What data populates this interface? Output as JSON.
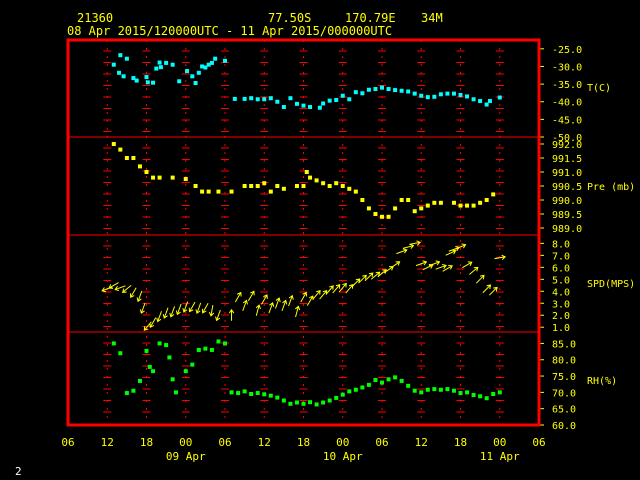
{
  "header": {
    "station_id": "21360",
    "latitude": "77.50S",
    "longitude": "170.79E",
    "elevation": "34M",
    "time_range": "08 Apr 2015/120000UTC - 11 Apr 2015/000000UTC"
  },
  "page_number": "2",
  "colors": {
    "frame": "#ff0000",
    "grid": "#ff0000",
    "labels": "#ffff00",
    "temperature": "#00ffff",
    "pressure": "#ffff00",
    "wind": "#ffff00",
    "humidity": "#00ff00"
  },
  "chart_data": {
    "type": "scatter",
    "x_axis": {
      "unit": "hours from 08 Apr 2015 00UTC",
      "range": [
        6,
        78
      ],
      "tick_labels": [
        "06",
        "12",
        "18",
        "00",
        "06",
        "12",
        "18",
        "00",
        "06",
        "12",
        "18",
        "00",
        "06"
      ],
      "date_labels": [
        "09 Apr",
        "10 Apr",
        "11 Apr"
      ]
    },
    "panels": [
      {
        "name": "temperature",
        "label": "T(C)",
        "ticks": [
          "-25.0",
          "-30.0",
          "-35.0",
          "-40.0",
          "-45.0",
          "-50.0"
        ],
        "ylim": [
          -50,
          -22.5
        ],
        "points": [
          [
            13,
            -29.5
          ],
          [
            14,
            -26.8
          ],
          [
            15,
            -27.8
          ],
          [
            13.8,
            -31.8
          ],
          [
            14.5,
            -32.8
          ],
          [
            16,
            -33.3
          ],
          [
            16.5,
            -34.0
          ],
          [
            18,
            -33.0
          ],
          [
            18.2,
            -34.5
          ],
          [
            19,
            -34.6
          ],
          [
            19.5,
            -30.6
          ],
          [
            20,
            -28.9
          ],
          [
            20.2,
            -30.2
          ],
          [
            21,
            -29.0
          ],
          [
            22,
            -29.5
          ],
          [
            23,
            -34.2
          ],
          [
            24.2,
            -31.3
          ],
          [
            25,
            -32.8
          ],
          [
            25.5,
            -34.7
          ],
          [
            26,
            -31.8
          ],
          [
            26.5,
            -30.0
          ],
          [
            27,
            -30.3
          ],
          [
            27.5,
            -29.5
          ],
          [
            28,
            -29.0
          ],
          [
            28.5,
            -27.8
          ],
          [
            30,
            -28.4
          ],
          [
            31.5,
            -39.2
          ],
          [
            33,
            -39.2
          ],
          [
            34,
            -39.0
          ],
          [
            35,
            -39.3
          ],
          [
            36,
            -39.3
          ],
          [
            37,
            -39.0
          ],
          [
            38,
            -40.0
          ],
          [
            39,
            -41.5
          ],
          [
            40,
            -39.0
          ],
          [
            41,
            -40.6
          ],
          [
            42,
            -41.1
          ],
          [
            43,
            -41.5
          ],
          [
            44.5,
            -41.7
          ],
          [
            45,
            -40.5
          ],
          [
            46,
            -39.7
          ],
          [
            47,
            -39.5
          ],
          [
            48,
            -38.3
          ],
          [
            49,
            -39.3
          ],
          [
            50,
            -37.3
          ],
          [
            51,
            -37.6
          ],
          [
            52,
            -36.6
          ],
          [
            53,
            -36.4
          ],
          [
            54,
            -36.0
          ],
          [
            55,
            -36.4
          ],
          [
            56,
            -36.7
          ],
          [
            57,
            -36.9
          ],
          [
            58,
            -37.1
          ],
          [
            59,
            -37.7
          ],
          [
            60,
            -38.3
          ],
          [
            61,
            -38.7
          ],
          [
            62,
            -38.6
          ],
          [
            63,
            -37.9
          ],
          [
            64,
            -37.7
          ],
          [
            65,
            -37.7
          ],
          [
            66,
            -38.1
          ],
          [
            67,
            -38.5
          ],
          [
            68,
            -39.3
          ],
          [
            69,
            -39.8
          ],
          [
            70,
            -40.8
          ],
          [
            70.5,
            -39.8
          ],
          [
            72,
            -38.8
          ]
        ]
      },
      {
        "name": "pressure",
        "label": "Pre (mb)",
        "ticks": [
          "992.0",
          "991.5",
          "991.0",
          "990.5",
          "990.0",
          "989.5",
          "989.0"
        ],
        "ylim": [
          988.75,
          992.25
        ],
        "points": [
          [
            13,
            992.0
          ],
          [
            14,
            991.8
          ],
          [
            15,
            991.5
          ],
          [
            16,
            991.5
          ],
          [
            17,
            991.2
          ],
          [
            18,
            991.0
          ],
          [
            19,
            990.8
          ],
          [
            20,
            990.8
          ],
          [
            22,
            990.8
          ],
          [
            24,
            990.75
          ],
          [
            25.5,
            990.5
          ],
          [
            26.5,
            990.3
          ],
          [
            27.5,
            990.3
          ],
          [
            29,
            990.3
          ],
          [
            31,
            990.3
          ],
          [
            33,
            990.5
          ],
          [
            34,
            990.5
          ],
          [
            35,
            990.5
          ],
          [
            36,
            990.6
          ],
          [
            37,
            990.3
          ],
          [
            38,
            990.5
          ],
          [
            39,
            990.4
          ],
          [
            41,
            990.5
          ],
          [
            42,
            990.5
          ],
          [
            42.5,
            991.0
          ],
          [
            43,
            990.8
          ],
          [
            44,
            990.7
          ],
          [
            45,
            990.6
          ],
          [
            46,
            990.5
          ],
          [
            47,
            990.6
          ],
          [
            48,
            990.5
          ],
          [
            49,
            990.4
          ],
          [
            50,
            990.3
          ],
          [
            51,
            990.0
          ],
          [
            52,
            989.7
          ],
          [
            53,
            989.5
          ],
          [
            54,
            989.4
          ],
          [
            55,
            989.4
          ],
          [
            56,
            989.7
          ],
          [
            57,
            990.0
          ],
          [
            58,
            990.0
          ],
          [
            59,
            989.6
          ],
          [
            60,
            989.7
          ],
          [
            61,
            989.8
          ],
          [
            62,
            989.9
          ],
          [
            63,
            989.9
          ],
          [
            65,
            989.9
          ],
          [
            66,
            989.8
          ],
          [
            67,
            989.8
          ],
          [
            68,
            989.8
          ],
          [
            69,
            989.9
          ],
          [
            70,
            990.0
          ],
          [
            71,
            990.2
          ]
        ]
      },
      {
        "name": "wind speed",
        "label": "SPD(MPS)",
        "ticks": [
          "8.0",
          "7.0",
          "6.0",
          "5.0",
          "4.0",
          "3.0",
          "2.0",
          "1.0"
        ],
        "ylim": [
          0.6,
          8.7
        ],
        "points": [
          [
            12,
            4.2,
            200
          ],
          [
            13,
            4.5,
            210
          ],
          [
            14,
            4.3,
            200
          ],
          [
            15,
            4.2,
            220
          ],
          [
            16,
            3.9,
            240
          ],
          [
            17,
            3.6,
            250
          ],
          [
            17.5,
            2.6,
            250
          ],
          [
            18.2,
            1.1,
            230
          ],
          [
            19,
            1.4,
            240
          ],
          [
            20,
            1.9,
            250
          ],
          [
            21,
            2.2,
            250
          ],
          [
            22,
            2.3,
            250
          ],
          [
            23,
            2.5,
            250
          ],
          [
            24,
            2.7,
            250
          ],
          [
            25,
            2.7,
            240
          ],
          [
            26,
            2.6,
            250
          ],
          [
            27,
            2.6,
            240
          ],
          [
            28,
            2.4,
            260
          ],
          [
            29,
            2.0,
            250
          ],
          [
            31,
            2.0,
            90
          ],
          [
            32,
            3.5,
            60
          ],
          [
            33,
            2.8,
            70
          ],
          [
            34,
            3.6,
            60
          ],
          [
            35,
            2.4,
            75
          ],
          [
            36,
            3.3,
            60
          ],
          [
            37,
            2.6,
            70
          ],
          [
            38,
            3.0,
            70
          ],
          [
            39,
            2.8,
            70
          ],
          [
            40,
            3.2,
            70
          ],
          [
            41,
            2.3,
            75
          ],
          [
            42,
            3.5,
            60
          ],
          [
            43,
            3.2,
            60
          ],
          [
            44,
            3.7,
            50
          ],
          [
            45,
            3.7,
            50
          ],
          [
            46,
            4.1,
            50
          ],
          [
            47,
            4.2,
            50
          ],
          [
            48,
            4.3,
            50
          ],
          [
            49,
            4.2,
            50
          ],
          [
            50,
            4.7,
            45
          ],
          [
            51,
            5.0,
            45
          ],
          [
            52,
            5.2,
            45
          ],
          [
            53,
            5.3,
            40
          ],
          [
            54,
            5.5,
            40
          ],
          [
            55,
            5.8,
            35
          ],
          [
            56,
            6.2,
            35
          ],
          [
            57,
            7.3,
            20
          ],
          [
            58,
            7.7,
            15
          ],
          [
            59,
            8.0,
            10
          ],
          [
            60,
            6.3,
            20
          ],
          [
            61,
            6.0,
            25
          ],
          [
            62,
            6.3,
            20
          ],
          [
            63,
            6.0,
            20
          ],
          [
            64,
            5.9,
            30
          ],
          [
            64.5,
            7.2,
            25
          ],
          [
            65,
            7.5,
            20
          ],
          [
            66,
            7.7,
            25
          ],
          [
            67,
            6.2,
            30
          ],
          [
            68,
            5.7,
            40
          ],
          [
            69,
            5.0,
            45
          ],
          [
            70,
            4.2,
            45
          ],
          [
            71,
            4.0,
            45
          ],
          [
            72,
            6.8,
            10
          ]
        ]
      },
      {
        "name": "relative humidity",
        "label": "RH(%)",
        "ticks": [
          "85.0",
          "80.0",
          "75.0",
          "70.0",
          "65.0",
          "60.0"
        ],
        "ylim": [
          60,
          88.5
        ],
        "points": [
          [
            13,
            85.0
          ],
          [
            14,
            82.0
          ],
          [
            15,
            69.8
          ],
          [
            16,
            70.5
          ],
          [
            17,
            73.5
          ],
          [
            18,
            82.7
          ],
          [
            18.5,
            77.8
          ],
          [
            19,
            76.5
          ],
          [
            20,
            85.0
          ],
          [
            21,
            84.5
          ],
          [
            21.5,
            80.7
          ],
          [
            22,
            74.0
          ],
          [
            22.5,
            70.0
          ],
          [
            24,
            76.5
          ],
          [
            25,
            78.5
          ],
          [
            26,
            83.0
          ],
          [
            27,
            83.4
          ],
          [
            28,
            83.0
          ],
          [
            29,
            85.6
          ],
          [
            30,
            85.0
          ],
          [
            31,
            70.0
          ],
          [
            32,
            69.8
          ],
          [
            33,
            70.3
          ],
          [
            34,
            69.5
          ],
          [
            35,
            69.8
          ],
          [
            36,
            69.4
          ],
          [
            37,
            69.0
          ],
          [
            38,
            68.4
          ],
          [
            39,
            67.5
          ],
          [
            40,
            66.5
          ],
          [
            41,
            66.9
          ],
          [
            42,
            66.5
          ],
          [
            43,
            67.0
          ],
          [
            44,
            66.3
          ],
          [
            45,
            66.9
          ],
          [
            46,
            67.5
          ],
          [
            47,
            68.3
          ],
          [
            48,
            69.3
          ],
          [
            49,
            70.3
          ],
          [
            50,
            70.8
          ],
          [
            51,
            71.5
          ],
          [
            52,
            72.3
          ],
          [
            53,
            73.8
          ],
          [
            54,
            73.0
          ],
          [
            55,
            74.0
          ],
          [
            56,
            74.6
          ],
          [
            57,
            73.5
          ],
          [
            58,
            72.0
          ],
          [
            59,
            70.5
          ],
          [
            60,
            70.0
          ],
          [
            61,
            70.8
          ],
          [
            62,
            71.0
          ],
          [
            63,
            70.8
          ],
          [
            64,
            71.0
          ],
          [
            65,
            70.5
          ],
          [
            66,
            69.8
          ],
          [
            67,
            70.0
          ],
          [
            68,
            69.2
          ],
          [
            69,
            68.8
          ],
          [
            70,
            68.2
          ],
          [
            71,
            69.5
          ],
          [
            72,
            70.0
          ]
        ]
      }
    ]
  }
}
